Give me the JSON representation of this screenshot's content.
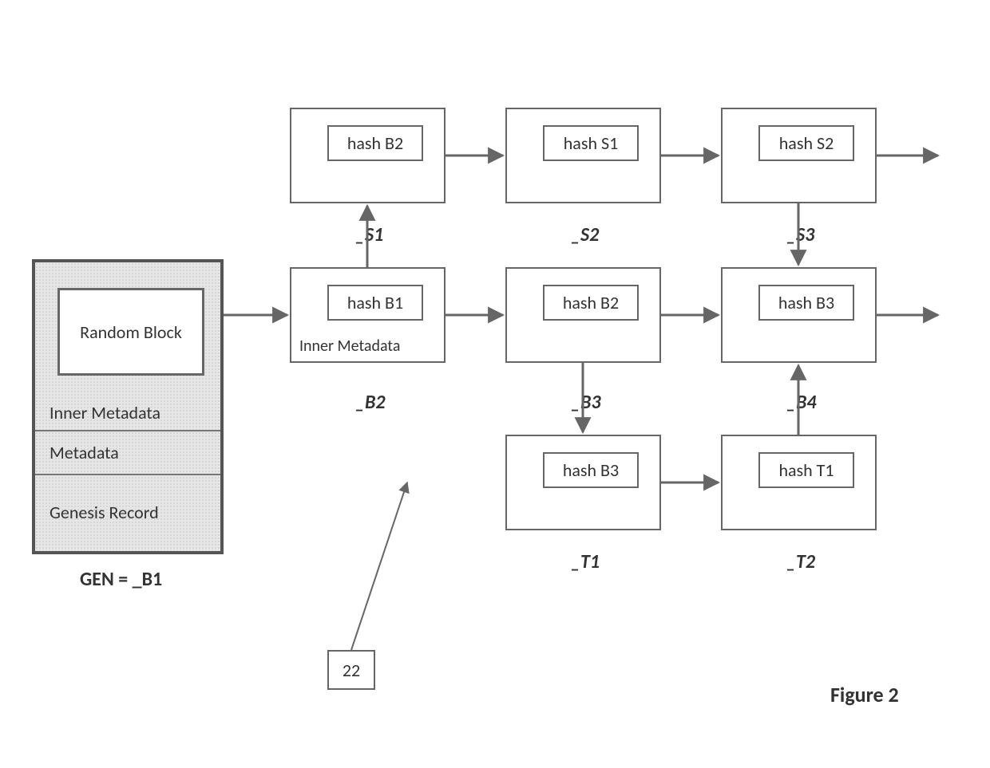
{
  "genesis": {
    "random": "Random Block",
    "inner_meta": "Inner Metadata",
    "metadata": "Metadata",
    "genesis_record": "Genesis Record",
    "caption": "GEN = _B1"
  },
  "row_s": {
    "s1": {
      "hash": "hash B2",
      "label": "_S1"
    },
    "s2": {
      "hash": "hash S1",
      "label": "_S2"
    },
    "s3": {
      "hash": "hash S2",
      "label": "_S3"
    }
  },
  "row_b": {
    "b2": {
      "hash": "hash B1",
      "inner_meta": "Inner Metadata",
      "label": "_B2"
    },
    "b3": {
      "hash": "hash B2",
      "label": "_B3"
    },
    "b4": {
      "hash": "hash B3",
      "label": "_B4"
    }
  },
  "row_t": {
    "t1": {
      "hash": "hash B3",
      "label": "_T1"
    },
    "t2": {
      "hash": "hash T1",
      "label": "_T2"
    }
  },
  "callout": "22",
  "figure_label": "Figure 2"
}
